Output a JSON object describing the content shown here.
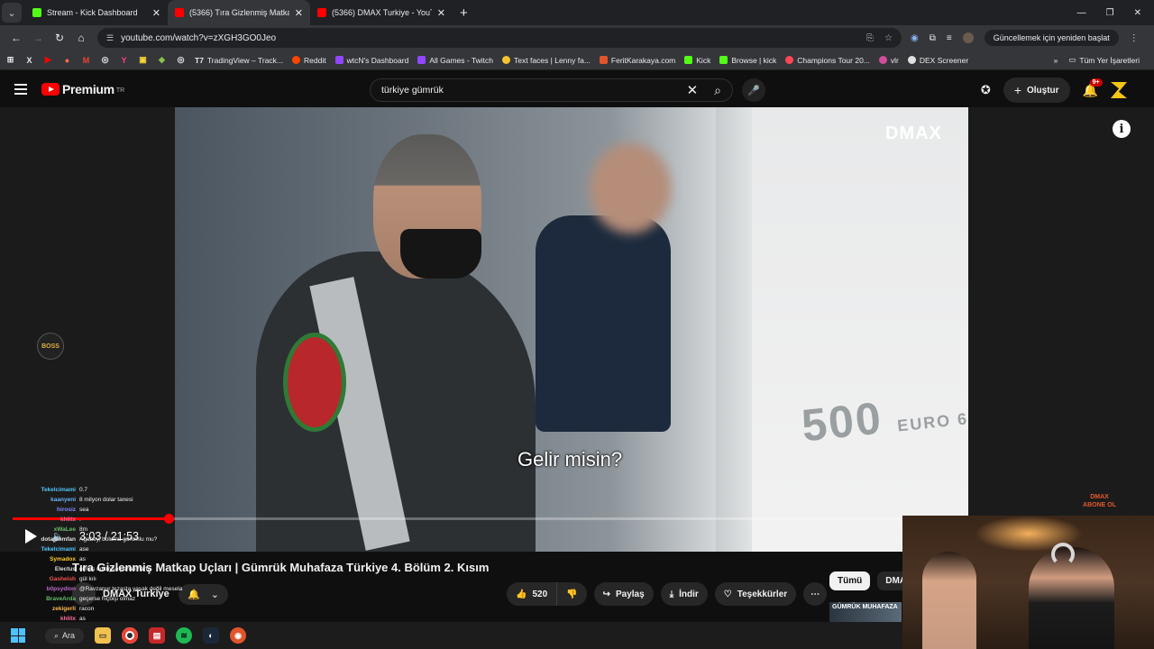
{
  "browser": {
    "tabs": [
      {
        "title": "Stream - Kick Dashboard",
        "color": "#53fc18",
        "active": false
      },
      {
        "title": "(5366) Tıra Gizlenmiş Matkap U",
        "color": "#ff0000",
        "active": true
      },
      {
        "title": "(5366) DMAX Turkiye - YouTub",
        "color": "#ff0000",
        "active": false
      }
    ],
    "url": "youtube.com/watch?v=zXGH3GO0Jeo",
    "update_label": "Güncellemek için yeniden başlat",
    "bookmarks": [
      {
        "label": "TradingView – Track...",
        "color": "#131722"
      },
      {
        "label": "Reddit",
        "color": "#ff4500"
      },
      {
        "label": "wtcN's Dashboard",
        "color": "#9146ff"
      },
      {
        "label": "All Games - Twitch",
        "color": "#9146ff"
      },
      {
        "label": "Text faces | Lenny fa...",
        "color": "#f4c430"
      },
      {
        "label": "FeritKarakaya.com",
        "color": "#e0552b"
      },
      {
        "label": "Kick",
        "color": "#53fc18"
      },
      {
        "label": "Browse | kick",
        "color": "#53fc18"
      },
      {
        "label": "Champions Tour 20...",
        "color": "#ff4655"
      },
      {
        "label": "vlr",
        "color": "#d04e9b"
      },
      {
        "label": "DEX Screener",
        "color": "#e0e0e0"
      }
    ],
    "all_bookmarks_label": "Tüm Yer İşaretleri"
  },
  "youtube": {
    "logo_text": "Premium",
    "country": "TR",
    "search_query": "türkiye gümrük",
    "create_label": "Oluştur",
    "notif_badge": "9+"
  },
  "video": {
    "watermark": "DMAX",
    "subtitle": "Gelir misin?",
    "time": "3:03 / 21:53",
    "progress": 0.1383,
    "truck_text": "500",
    "truck_sub": "EURO 6",
    "corner_badge_1": "DMAX",
    "corner_badge_2": "ABONE OL",
    "boss_label": "BOSS",
    "title": "Tıra Gizlenmiş Matkap Uçları | Gümrük Muhafaza Türkiye 4. Bölüm 2. Kısım",
    "channel": "DMAX Turkiye",
    "likes": "520",
    "share_label": "Paylaş",
    "download_label": "İndir",
    "thanks_label": "Teşekkürler",
    "chips": [
      "Tümü",
      "DMAX"
    ],
    "next_thumb_text": "GÜMRÜK MUHAFAZA"
  },
  "chat": [
    {
      "user": "Tekelcimami",
      "color": "#4fc3f7",
      "msg": "0.7"
    },
    {
      "user": "kaanyeni",
      "color": "#64b5f6",
      "msg": "8 milyon dolar tanesi"
    },
    {
      "user": "hirosiz",
      "color": "#7e8cff",
      "msg": "sea"
    },
    {
      "user": "khlitx",
      "color": "#ff6b9d",
      "msg": "."
    },
    {
      "user": "xWaLee",
      "color": "#66bb6a",
      "msg": "8m"
    },
    {
      "user": "dotajahmfan",
      "color": "#e0e0e0",
      "msg": "Ağabey, bolumu görumlu mu?"
    },
    {
      "user": "Tekelcimami",
      "color": "#4fc3f7",
      "msg": "ase"
    },
    {
      "user": "Symadox",
      "color": "#ffca28",
      "msg": "as"
    },
    {
      "user": "Electus",
      "color": "#e0e0e0",
      "msg": "olmas uokuysa pahali harbi"
    },
    {
      "user": "Gasheish",
      "color": "#ef5350",
      "msg": "gül kılı"
    },
    {
      "user": "b0psydion",
      "color": "#ba68c8",
      "msg": "@Ravzanur tezasta yasak değil mesela"
    },
    {
      "user": "BraveArda",
      "color": "#66bb6a",
      "msg": "geçerse hiçbişi olmaz"
    },
    {
      "user": "zekigerli",
      "color": "#ffb74d",
      "msg": "racon"
    },
    {
      "user": "khlitx",
      "color": "#ff6b9d",
      "msg": "as"
    }
  ],
  "taskbar": {
    "search_label": "Ara"
  }
}
